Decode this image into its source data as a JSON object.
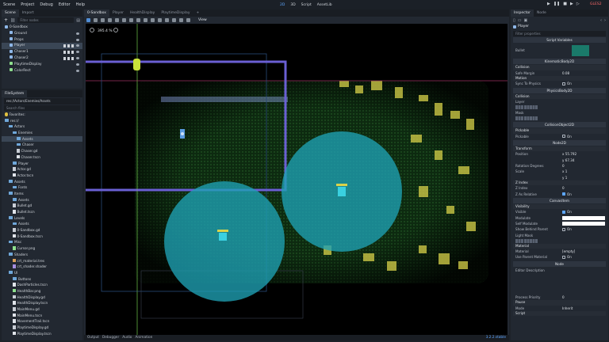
{
  "menu": [
    "Scene",
    "Project",
    "Debug",
    "Editor",
    "Help"
  ],
  "modes": [
    "2D",
    "3D",
    "Script",
    "AssetLib"
  ],
  "active_mode": "2D",
  "renderer": "GLES2",
  "scene_dock": {
    "tabs": [
      "Scene",
      "Import"
    ],
    "filter_placeholder": "Filter nodes",
    "nodes": [
      {
        "label": "0-Sandbox",
        "depth": 0,
        "color": "#8eb7e8",
        "selected": false
      },
      {
        "label": "Ground",
        "depth": 1,
        "color": "#8eb7e8",
        "selected": false
      },
      {
        "label": "Props",
        "depth": 1,
        "color": "#8eb7e8",
        "selected": false
      },
      {
        "label": "Player",
        "depth": 1,
        "color": "#8eb7e8",
        "selected": true
      },
      {
        "label": "Chaser1",
        "depth": 1,
        "color": "#8eb7e8",
        "selected": false
      },
      {
        "label": "Chaser2",
        "depth": 1,
        "color": "#8eb7e8",
        "selected": false
      },
      {
        "label": "PlaytimeDisplay",
        "depth": 1,
        "color": "#8ee08e",
        "selected": false
      },
      {
        "label": "ColorRect",
        "depth": 1,
        "color": "#8ee08e",
        "selected": false
      }
    ]
  },
  "filesystem": {
    "title": "FileSystem",
    "path": "res://Actors/Enemies/Assets",
    "search_placeholder": "Search files",
    "items": [
      {
        "label": "Favorites:",
        "depth": 0,
        "type": "fav"
      },
      {
        "label": "res://",
        "depth": 0,
        "type": "folder"
      },
      {
        "label": "Actors",
        "depth": 1,
        "type": "folder"
      },
      {
        "label": "Enemies",
        "depth": 2,
        "type": "folder"
      },
      {
        "label": "Assets",
        "depth": 3,
        "type": "folder",
        "selected": true
      },
      {
        "label": "Chaser",
        "depth": 3,
        "type": "folder"
      },
      {
        "label": "Chaser.gd",
        "depth": 3,
        "type": "gd"
      },
      {
        "label": "Chaser.tscn",
        "depth": 3,
        "type": "tscn"
      },
      {
        "label": "Player",
        "depth": 2,
        "type": "folder"
      },
      {
        "label": "Actor.gd",
        "depth": 2,
        "type": "gd"
      },
      {
        "label": "Actor.tscn",
        "depth": 2,
        "type": "tscn"
      },
      {
        "label": "Assets",
        "depth": 1,
        "type": "folder"
      },
      {
        "label": "Fonts",
        "depth": 2,
        "type": "folder"
      },
      {
        "label": "Items",
        "depth": 1,
        "type": "folder"
      },
      {
        "label": "Assets",
        "depth": 2,
        "type": "folder"
      },
      {
        "label": "Bullet.gd",
        "depth": 2,
        "type": "gd"
      },
      {
        "label": "Bullet.tscn",
        "depth": 2,
        "type": "tscn"
      },
      {
        "label": "Levels",
        "depth": 1,
        "type": "folder"
      },
      {
        "label": "Assets",
        "depth": 2,
        "type": "folder"
      },
      {
        "label": "0-Sandbox.gd",
        "depth": 2,
        "type": "gd"
      },
      {
        "label": "0-Sandbox.tscn",
        "depth": 2,
        "type": "tscn"
      },
      {
        "label": "Misc",
        "depth": 1,
        "type": "folder"
      },
      {
        "label": "Cursor.png",
        "depth": 2,
        "type": "png"
      },
      {
        "label": "Shaders",
        "depth": 1,
        "type": "folder"
      },
      {
        "label": "crt_material.tres",
        "depth": 2,
        "type": "tres"
      },
      {
        "label": "crt_shader.shader",
        "depth": 2,
        "type": "shader"
      },
      {
        "label": "UI",
        "depth": 1,
        "type": "folder"
      },
      {
        "label": "Buttons",
        "depth": 2,
        "type": "folder"
      },
      {
        "label": "DashParticles.tscn",
        "depth": 2,
        "type": "tscn"
      },
      {
        "label": "HealthBar.png",
        "depth": 2,
        "type": "png"
      },
      {
        "label": "HealthDisplay.gd",
        "depth": 2,
        "type": "gd"
      },
      {
        "label": "HealthDisplay.tscn",
        "depth": 2,
        "type": "tscn"
      },
      {
        "label": "MainMenu.gd",
        "depth": 2,
        "type": "gd"
      },
      {
        "label": "MainMenu.tscn",
        "depth": 2,
        "type": "tscn"
      },
      {
        "label": "MovementTrail.tscn",
        "depth": 2,
        "type": "tscn"
      },
      {
        "label": "PlaytimeDisplay.gd",
        "depth": 2,
        "type": "gd"
      },
      {
        "label": "PlaytimeDisplay.tscn",
        "depth": 2,
        "type": "tscn"
      }
    ]
  },
  "viewport": {
    "tabs": [
      "0-Sandbox",
      "Player",
      "HealthDisplay",
      "PlaytimeDisplay"
    ],
    "active_tab": "0-Sandbox",
    "zoom": "395.4 %",
    "view_label": "View",
    "bottom_tabs": [
      "Output",
      "Debugger",
      "Audio",
      "Animation"
    ],
    "version": "3.2.2.stable",
    "colors": {
      "circle": "#1fa2b5",
      "rail": "#6a5fd3",
      "green": "#1b6b24"
    }
  },
  "inspector": {
    "tabs": [
      "Inspector",
      "Node"
    ],
    "node": "Player",
    "filter_placeholder": "Filter properties",
    "script_variables": "Script Variables",
    "bullet_label": "Bullet",
    "kinematic": "KinematicBody2D",
    "collision_sub": "Collision",
    "safe_margin_label": "Safe Margin",
    "safe_margin_value": "0.08",
    "motion_sub": "Motion",
    "sync_label": "Sync To Physics",
    "sync_value": "On",
    "physics_body": "PhysicsBody2D",
    "collision2_sub": "Collision",
    "layer_label": "Layer",
    "mask_label": "Mask",
    "collision_object": "CollisionObject2D",
    "pickable_sub": "Pickable",
    "pickable_label": "Pickable",
    "pickable_value": "On",
    "node2d": "Node2D",
    "transform_sub": "Transform",
    "position_label": "Position",
    "position_x": "x 55.792",
    "position_y": "y 67.34",
    "rotation_label": "Rotation Degrees",
    "rotation_value": "0",
    "scale_label": "Scale",
    "scale_x": "x 1",
    "scale_y": "y 1",
    "zindex_sub": "Z Index",
    "zindex_label": "Z Index",
    "zindex_value": "0",
    "zrel_label": "Z As Relative",
    "zrel_value": "On",
    "canvas_item": "CanvasItem",
    "visibility_sub": "Visibility",
    "visible_label": "Visible",
    "visible_value": "On",
    "modulate_label": "Modulate",
    "self_modulate_label": "Self Modulate",
    "show_behind_label": "Show Behind Parent",
    "show_behind_value": "On",
    "light_mask_label": "Light Mask",
    "material_sub": "Material",
    "material_label": "Material",
    "material_value": "[empty]",
    "use_parent_label": "Use Parent Material",
    "use_parent_value": "On",
    "node_section": "Node",
    "editor_desc_label": "Editor Description",
    "process_priority_label": "Process Priority",
    "process_priority_value": "0",
    "pause_sub": "Pause",
    "mode_label": "Mode",
    "mode_value": "Inherit",
    "script_sub": "Script"
  }
}
